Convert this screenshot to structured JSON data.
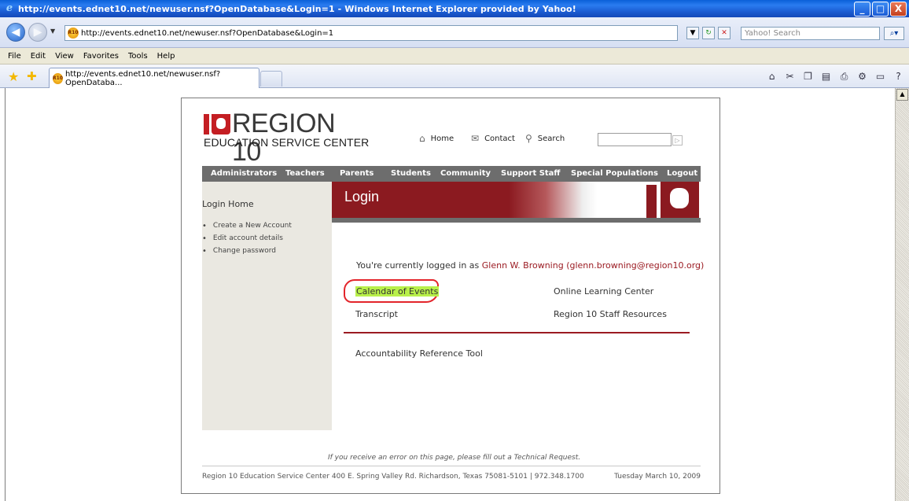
{
  "window": {
    "title": "http://events.ednet10.net/newuser.nsf?OpenDatabase&Login=1 - Windows Internet Explorer provided by Yahoo!",
    "minimize": "_",
    "maximize": "□",
    "close": "X"
  },
  "address_bar": {
    "url": "http://events.ednet10.net/newuser.nsf?OpenDatabase&Login=1",
    "search_placeholder": "Yahoo! Search"
  },
  "menu": [
    "File",
    "Edit",
    "View",
    "Favorites",
    "Tools",
    "Help"
  ],
  "tab": {
    "label": "http://events.ednet10.net/newuser.nsf?OpenDataba..."
  },
  "site": {
    "logo_title": "REGION 10",
    "logo_subtitle": "EDUCATION SERVICE CENTER",
    "util_links": {
      "home": "Home",
      "contact": "Contact",
      "search": "Search"
    },
    "nav": [
      "Administrators",
      "Teachers",
      "Parents",
      "Students",
      "Community",
      "Support Staff",
      "Special Populations",
      "Logout"
    ],
    "sidebar": {
      "heading": "Login Home",
      "items": [
        "Create a New Account",
        "Edit account details",
        "Change password"
      ]
    },
    "banner_title": "Login",
    "logged_in_prefix": "You're currently logged in as ",
    "user": "Glenn W. Browning (glenn.browning@region10.org)",
    "links": {
      "calendar": "Calendar of Events",
      "online_learning": "Online Learning Center",
      "transcript": "Transcript",
      "staff_resources": "Region 10 Staff Resources",
      "accountability": "Accountability Reference Tool"
    },
    "error_note": "If you receive an error on this page, please fill out a Technical Request.",
    "footer_address": "Region 10 Education Service Center 400 E. Spring Valley Rd. Richardson, Texas 75081-5101 | 972.348.1700",
    "footer_date": "Tuesday March 10, 2009"
  },
  "colors": {
    "brand_red": "#c41e23",
    "banner_red": "#8b1a20",
    "highlight_green": "#b8f04a",
    "annotation_red": "#e3252b"
  }
}
